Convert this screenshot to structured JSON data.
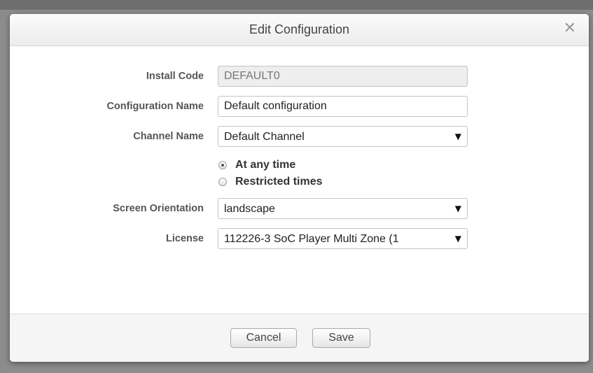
{
  "dialog": {
    "title": "Edit Configuration",
    "close_glyph": "✕"
  },
  "form": {
    "install_code": {
      "label": "Install Code",
      "value": "DEFAULT0"
    },
    "configuration_name": {
      "label": "Configuration Name",
      "value": "Default configuration"
    },
    "channel_name": {
      "label": "Channel Name",
      "selected": "Default Channel"
    },
    "schedule": {
      "options": [
        {
          "label": "At any time",
          "checked": true
        },
        {
          "label": "Restricted times",
          "checked": false
        }
      ]
    },
    "screen_orientation": {
      "label": "Screen Orientation",
      "selected": "landscape"
    },
    "license": {
      "label": "License",
      "selected": "112226-3 SoC Player Multi Zone (1"
    }
  },
  "footer": {
    "cancel_label": "Cancel",
    "save_label": "Save"
  },
  "icons": {
    "close": "close-icon",
    "dropdown": "chevron-down-icon",
    "dropdown_glyph": "▼"
  }
}
